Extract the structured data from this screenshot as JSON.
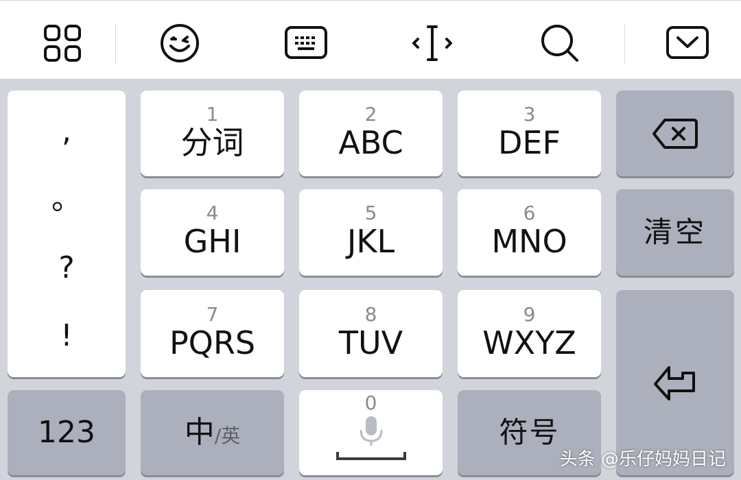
{
  "toolbar": {
    "items": [
      {
        "name": "grid-apps-icon"
      },
      {
        "name": "emoji-icon"
      },
      {
        "name": "keyboard-icon"
      },
      {
        "name": "cursor-move-icon"
      },
      {
        "name": "search-icon"
      },
      {
        "name": "hide-keyboard-icon"
      }
    ]
  },
  "punctuation": [
    ",",
    "。",
    "?",
    "!"
  ],
  "keys": [
    {
      "num": "1",
      "label": "分词"
    },
    {
      "num": "2",
      "label": "ABC"
    },
    {
      "num": "3",
      "label": "DEF"
    },
    {
      "num": "4",
      "label": "GHI"
    },
    {
      "num": "5",
      "label": "JKL"
    },
    {
      "num": "6",
      "label": "MNO"
    },
    {
      "num": "7",
      "label": "PQRS"
    },
    {
      "num": "8",
      "label": "TUV"
    },
    {
      "num": "9",
      "label": "WXYZ"
    }
  ],
  "bottom": {
    "numbers_label": "123",
    "lang_main": "中",
    "lang_sub": "/英",
    "space_num": "0",
    "symbols_label": "符号"
  },
  "side": {
    "backspace_icon": "backspace-icon",
    "clear_label": "清空",
    "enter_icon": "return-icon"
  },
  "watermark": "头条 @乐仔妈妈日记",
  "colors": {
    "keyboard_bg": "#d1d4db",
    "light_key": "#ffffff",
    "dark_key": "#abb0bc",
    "number_hint": "#8a8a8a"
  }
}
